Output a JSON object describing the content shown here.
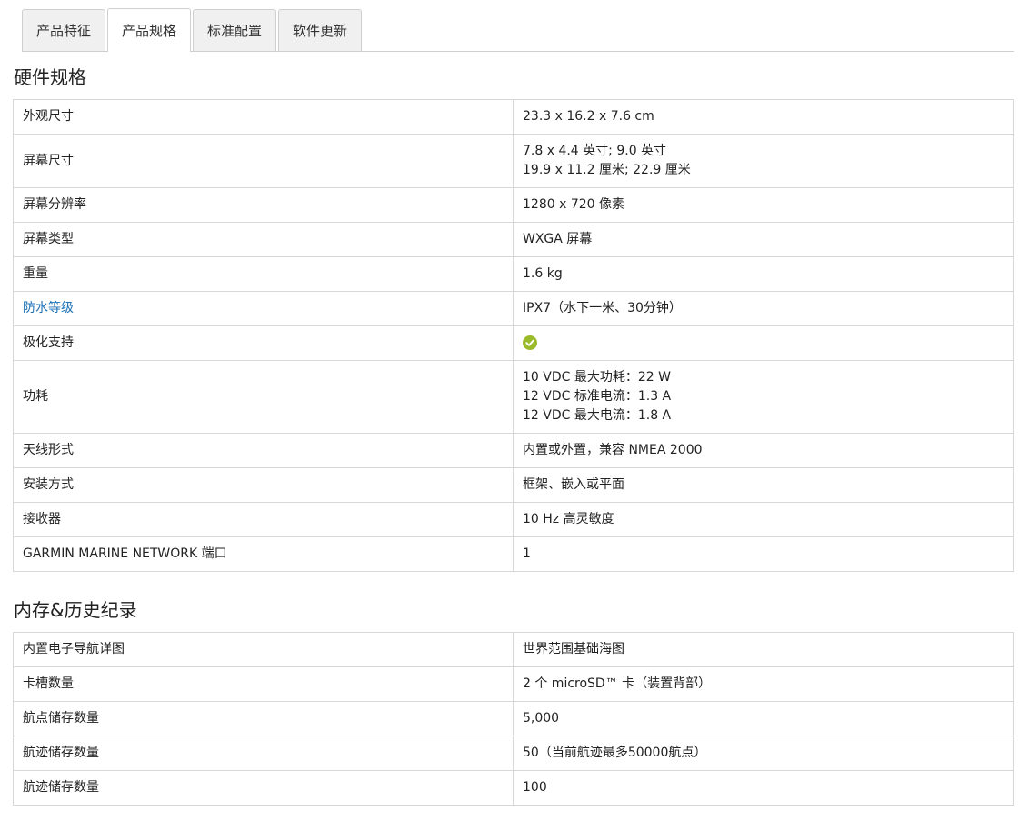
{
  "tabs": [
    {
      "label": "产品特征",
      "active": false
    },
    {
      "label": "产品规格",
      "active": true
    },
    {
      "label": "标准配置",
      "active": false
    },
    {
      "label": "软件更新",
      "active": false
    }
  ],
  "hardware": {
    "title": "硬件规格",
    "rows": [
      {
        "key": "外观尺寸",
        "lines": [
          "23.3 x 16.2 x 7.6 cm"
        ]
      },
      {
        "key": "屏幕尺寸",
        "lines": [
          "7.8 x 4.4 英寸; 9.0 英寸",
          "19.9 x 11.2 厘米; 22.9 厘米"
        ]
      },
      {
        "key": "屏幕分辨率",
        "lines": [
          "1280 x 720 像素"
        ]
      },
      {
        "key": "屏幕类型",
        "lines": [
          "WXGA 屏幕"
        ]
      },
      {
        "key": "重量",
        "lines": [
          "1.6 kg"
        ]
      },
      {
        "key": "防水等级",
        "link": true,
        "lines": [
          "IPX7（水下一米、30分钟）"
        ]
      },
      {
        "key": "极化支持",
        "check": true,
        "lines": []
      },
      {
        "key": "功耗",
        "lines": [
          "10 VDC 最大功耗：22 W",
          "12 VDC 标准电流：1.3 A",
          "12 VDC 最大电流：1.8 A"
        ]
      },
      {
        "key": "天线形式",
        "lines": [
          "内置或外置，兼容 NMEA 2000"
        ]
      },
      {
        "key": "安装方式",
        "lines": [
          "框架、嵌入或平面"
        ]
      },
      {
        "key": "接收器",
        "lines": [
          "10 Hz 高灵敏度"
        ]
      },
      {
        "key": "GARMIN MARINE NETWORK 端口",
        "lines": [
          "1"
        ]
      }
    ]
  },
  "memory": {
    "title": "内存&历史纪录",
    "rows": [
      {
        "key": "内置电子导航详图",
        "lines": [
          "世界范围基础海图"
        ]
      },
      {
        "key": "卡槽数量",
        "lines": [
          "2 个 microSD™ 卡（装置背部）"
        ]
      },
      {
        "key": "航点储存数量",
        "lines": [
          "5,000"
        ]
      },
      {
        "key": "航迹储存数量",
        "lines": [
          "50（当前航迹最多50000航点）"
        ]
      },
      {
        "key": "航迹储存数量",
        "lines": [
          "100"
        ]
      }
    ]
  },
  "colors": {
    "check": "#9aba2c",
    "link": "#1a6fb5",
    "border": "#d7d7d7"
  }
}
